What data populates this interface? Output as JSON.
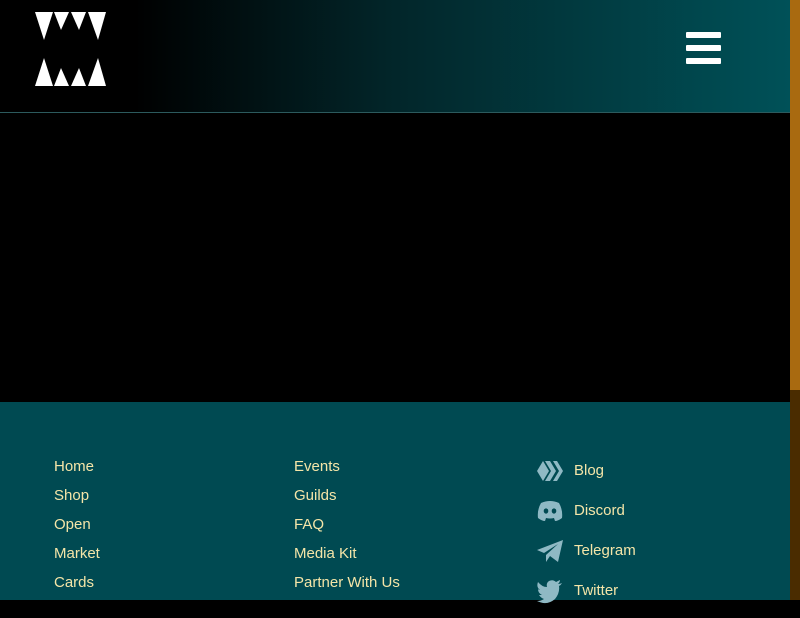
{
  "header": {
    "logo": "fangs-logo-icon",
    "menu_icon": "hamburger-menu-icon"
  },
  "footer": {
    "column1": [
      {
        "label": "Home"
      },
      {
        "label": "Shop"
      },
      {
        "label": "Open"
      },
      {
        "label": "Market"
      },
      {
        "label": "Cards"
      }
    ],
    "column2": [
      {
        "label": "Events"
      },
      {
        "label": "Guilds"
      },
      {
        "label": "FAQ"
      },
      {
        "label": "Media Kit"
      },
      {
        "label": "Partner With Us"
      }
    ],
    "social": [
      {
        "label": "Blog",
        "icon": "hive-icon"
      },
      {
        "label": "Discord",
        "icon": "discord-icon"
      },
      {
        "label": "Telegram",
        "icon": "telegram-icon"
      },
      {
        "label": "Twitter",
        "icon": "twitter-icon"
      }
    ]
  },
  "colors": {
    "link": "#f4e5a8",
    "footer_bg": "#004a52",
    "header_gradient_end": "#005158",
    "scroll_thumb": "#a96a10"
  }
}
